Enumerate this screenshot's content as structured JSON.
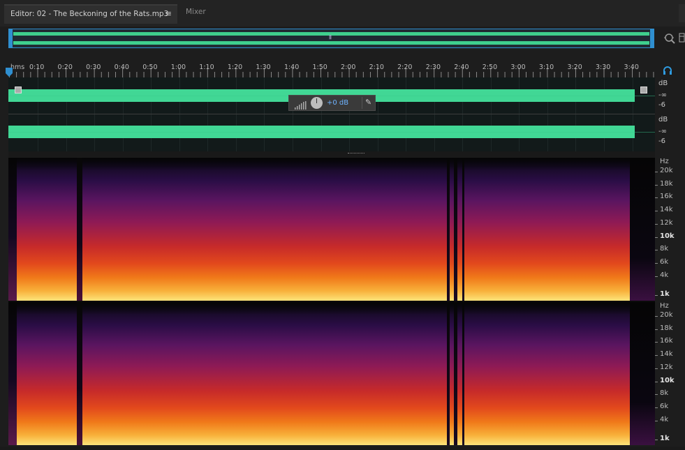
{
  "tabs": {
    "editor_label": "Editor: 02 - The Beckoning of the Rats.mp3",
    "editor_menu_icon": "≡",
    "mixer_label": "Mixer"
  },
  "overview": {
    "grip_icon": "|||"
  },
  "ruler": {
    "unit": "hms",
    "ticks": [
      "0:10",
      "0:20",
      "0:30",
      "0:40",
      "0:50",
      "1:00",
      "1:10",
      "1:20",
      "1:30",
      "1:40",
      "1:50",
      "2:00",
      "2:10",
      "2:20",
      "2:30",
      "2:40",
      "2:50",
      "3:00",
      "3:10",
      "3:20",
      "3:30",
      "3:40"
    ]
  },
  "level_scale": {
    "unit": "dB",
    "labels": [
      "-∞",
      "-6"
    ]
  },
  "hud": {
    "value": "+0 dB",
    "pin_icon": "✎"
  },
  "spectral": {
    "unit": "Hz",
    "labels": [
      "20k",
      "18k",
      "16k",
      "14k",
      "12k",
      "10k",
      "8k",
      "6k",
      "4k",
      "1k"
    ]
  },
  "colors": {
    "waveform": "#41d795",
    "accent": "#2f8fd0",
    "hud_value": "#6fb3ff"
  }
}
